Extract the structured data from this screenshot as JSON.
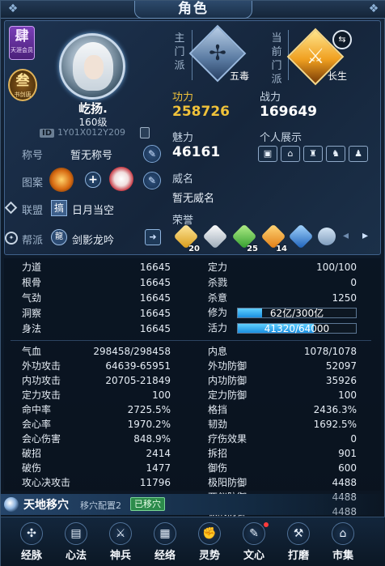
{
  "window": {
    "title": "角色"
  },
  "profile": {
    "vip_badge_big": "肆",
    "vip_badge_small": "天涯会员",
    "rank_badge_big": "叁",
    "rank_badge_small": "书剑唐",
    "name": "屹扬.",
    "level": "160级",
    "id_tag": "ID",
    "id_value": "1Y01X012Y209"
  },
  "rows": {
    "title_label": "称号",
    "title_value": "暂无称号",
    "pattern_label": "图案",
    "alliance_label": "联盟",
    "alliance_mark": "搞",
    "alliance_value": "日月当空",
    "faction_label": "帮派",
    "faction_mark": "龍",
    "faction_value": "剑影龙吟"
  },
  "sects": {
    "main_label": "主门派",
    "main_name": "五毒",
    "current_label": "当前门派",
    "current_name": "长生"
  },
  "power": {
    "gong_label": "功力",
    "gong_value": "258726",
    "zhan_label": "战力",
    "zhan_value": "169649",
    "charm_label": "魅力",
    "charm_value": "46161",
    "showcase_label": "个人展示",
    "fame_label": "威名",
    "fame_value": "暂无威名",
    "honor_label": "荣誉",
    "honors": [
      {
        "icon": "gold-honor-icon",
        "count": "20"
      },
      {
        "icon": "white-honor-icon",
        "count": ""
      },
      {
        "icon": "green-honor-icon",
        "count": "25"
      },
      {
        "icon": "orange-honor-icon",
        "count": "14"
      },
      {
        "icon": "blue-list-honor-icon",
        "count": ""
      },
      {
        "icon": "silver-gem-honor-icon",
        "count": ""
      }
    ]
  },
  "basic_stats_left": [
    {
      "label": "力道",
      "value": "16645"
    },
    {
      "label": "根骨",
      "value": "16645"
    },
    {
      "label": "气劲",
      "value": "16645"
    },
    {
      "label": "洞察",
      "value": "16645"
    },
    {
      "label": "身法",
      "value": "16645"
    }
  ],
  "basic_stats_right": [
    {
      "label": "定力",
      "value": "100/100"
    },
    {
      "label": "杀戮",
      "value": "0"
    },
    {
      "label": "杀意",
      "value": "1250"
    }
  ],
  "bars": {
    "xiuwei_label": "修为",
    "xiuwei_text": "62亿/300亿",
    "xiuwei_fraction": 0.207,
    "huoli_label": "活力",
    "huoli_text": "41320/64000",
    "huoli_fraction": 0.646
  },
  "combat_left": [
    {
      "label": "气血",
      "value": "298458/298458"
    },
    {
      "label": "外功攻击",
      "value": "64639-65951"
    },
    {
      "label": "内功攻击",
      "value": "20705-21849"
    },
    {
      "label": "定力攻击",
      "value": "100"
    },
    {
      "label": "命中率",
      "value": "2725.5%"
    },
    {
      "label": "会心率",
      "value": "1970.2%"
    },
    {
      "label": "会心伤害",
      "value": "848.9%"
    },
    {
      "label": "破招",
      "value": "2414"
    },
    {
      "label": "破伤",
      "value": "1477"
    },
    {
      "label": "攻心决攻击",
      "value": "11796"
    }
  ],
  "combat_right": [
    {
      "label": "内息",
      "value": "1078/1078"
    },
    {
      "label": "外功防御",
      "value": "52097"
    },
    {
      "label": "内功防御",
      "value": "35926"
    },
    {
      "label": "定力防御",
      "value": "100"
    },
    {
      "label": "格挡",
      "value": "2436.3%"
    },
    {
      "label": "韧劲",
      "value": "1692.5%"
    },
    {
      "label": "疗伤效果",
      "value": "0"
    },
    {
      "label": "拆招",
      "value": "901"
    },
    {
      "label": "御伤",
      "value": "600"
    },
    {
      "label": "极阳防御",
      "value": "4488"
    },
    {
      "label": "两仪防御",
      "value": "4488"
    },
    {
      "label": "极阴防御",
      "value": "4488"
    }
  ],
  "acupoint": {
    "title": "天地移穴",
    "config": "移穴配置2",
    "status": "已移穴"
  },
  "nav": [
    {
      "label": "经脉",
      "icon": "meridian-icon",
      "glyph": "✣"
    },
    {
      "label": "心法",
      "icon": "scroll-icon",
      "glyph": "▤"
    },
    {
      "label": "神兵",
      "icon": "weapon-icon",
      "glyph": "⚔"
    },
    {
      "label": "经络",
      "icon": "grid-icon",
      "glyph": "▦"
    },
    {
      "label": "灵势",
      "icon": "fist-icon",
      "glyph": "✊"
    },
    {
      "label": "文心",
      "icon": "brush-icon",
      "glyph": "✎"
    },
    {
      "label": "打磨",
      "icon": "hammer-icon",
      "glyph": "⚒"
    },
    {
      "label": "市集",
      "icon": "market-icon",
      "glyph": "⌂"
    }
  ],
  "colors": {
    "gold": "#f0c23a",
    "bar_fill": "#2ea6f0",
    "badge_green": "#2c8b4b"
  }
}
